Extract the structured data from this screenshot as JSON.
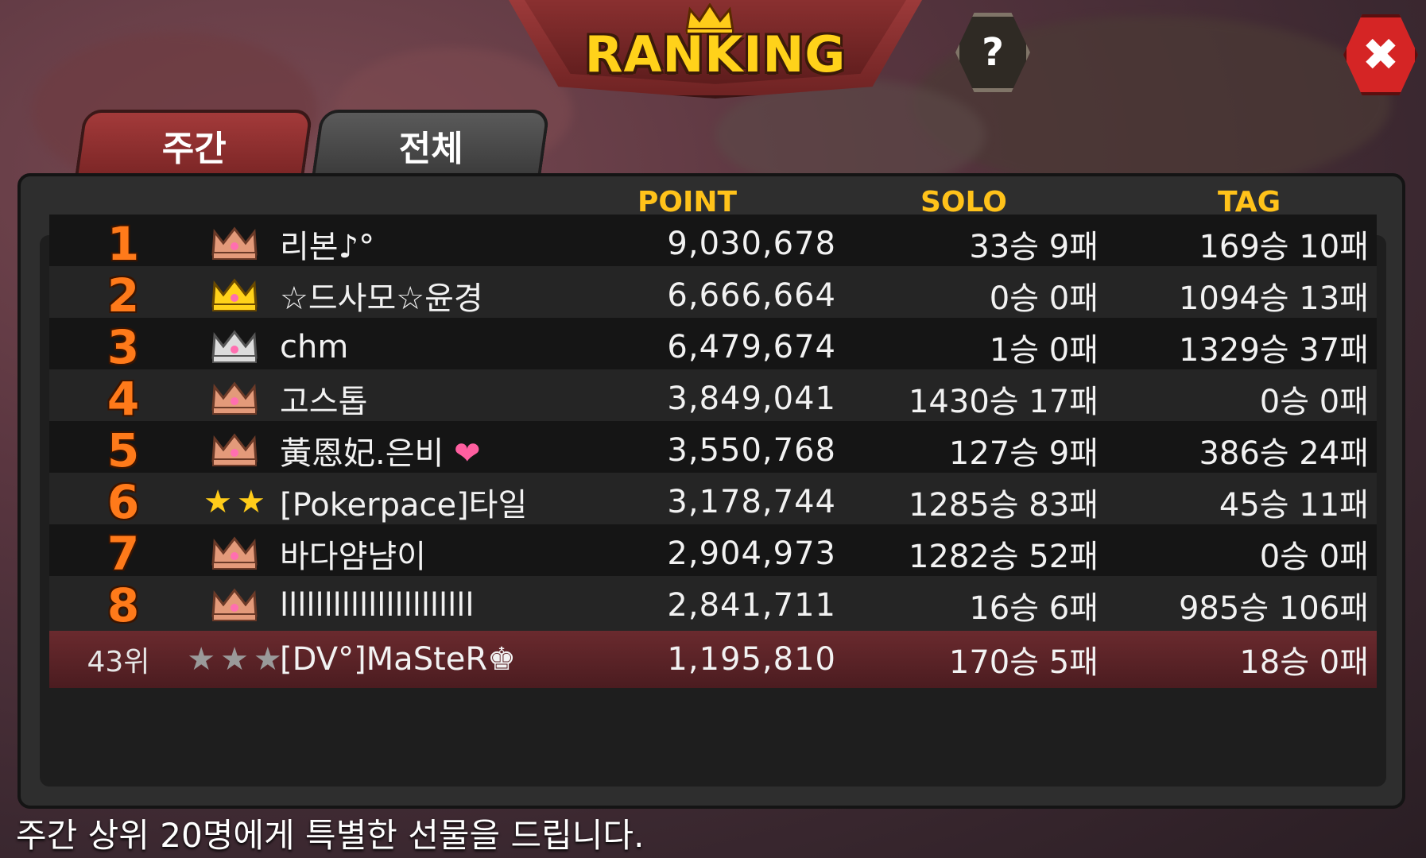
{
  "header": {
    "title": "RANKING",
    "help_label": "?",
    "close_label": "✖"
  },
  "tabs": [
    {
      "label": "주간",
      "active": true
    },
    {
      "label": "전체",
      "active": false
    }
  ],
  "columns": {
    "point": "POINT",
    "solo": "SOLO",
    "tag": "TAG"
  },
  "rows": [
    {
      "rank": "1",
      "badge": "bronze-crown",
      "name": "리본♪°",
      "point": "9,030,678",
      "solo": "33승 9패",
      "tag": "169승 10패"
    },
    {
      "rank": "2",
      "badge": "gold-crown",
      "name": "☆드사모☆윤경",
      "point": "6,666,664",
      "solo": "0승 0패",
      "tag": "1094승 13패"
    },
    {
      "rank": "3",
      "badge": "silver-crown",
      "name": "chm",
      "point": "6,479,674",
      "solo": "1승 0패",
      "tag": "1329승 37패"
    },
    {
      "rank": "4",
      "badge": "bronze-crown",
      "name": "고스톱",
      "point": "3,849,041",
      "solo": "1430승 17패",
      "tag": "0승 0패"
    },
    {
      "rank": "5",
      "badge": "bronze-crown",
      "name": "黃恩妃.은비",
      "point": "3,550,768",
      "solo": "127승 9패",
      "tag": "386승 24패"
    },
    {
      "rank": "6",
      "badge": "two-gold-stars",
      "name": "[Pokerpace]타일",
      "point": "3,178,744",
      "solo": "1285승 83패",
      "tag": "45승 11패"
    },
    {
      "rank": "7",
      "badge": "bronze-crown",
      "name": "바다얌냠이",
      "point": "2,904,973",
      "solo": "1282승 52패",
      "tag": "0승 0패"
    },
    {
      "rank": "8",
      "badge": "bronze-crown",
      "name": "llllllllllllllllllllll",
      "point": "2,841,711",
      "solo": "16승 6패",
      "tag": "985승 106패"
    }
  ],
  "my_row": {
    "rank": "43위",
    "badge": "three-silver-stars",
    "name": "[DV°]MaSteR♚",
    "point": "1,195,810",
    "solo": "170승 5패",
    "tag": "18승 0패"
  },
  "footer": "주간 상위 20명에게 특별한 선물을 드립니다.",
  "colors": {
    "gold": "#ffc21a",
    "rank_orange": "#ff7a1a",
    "tab_red": "#a33a3a",
    "close_red": "#d52525",
    "heart": "#ff5fa0"
  }
}
